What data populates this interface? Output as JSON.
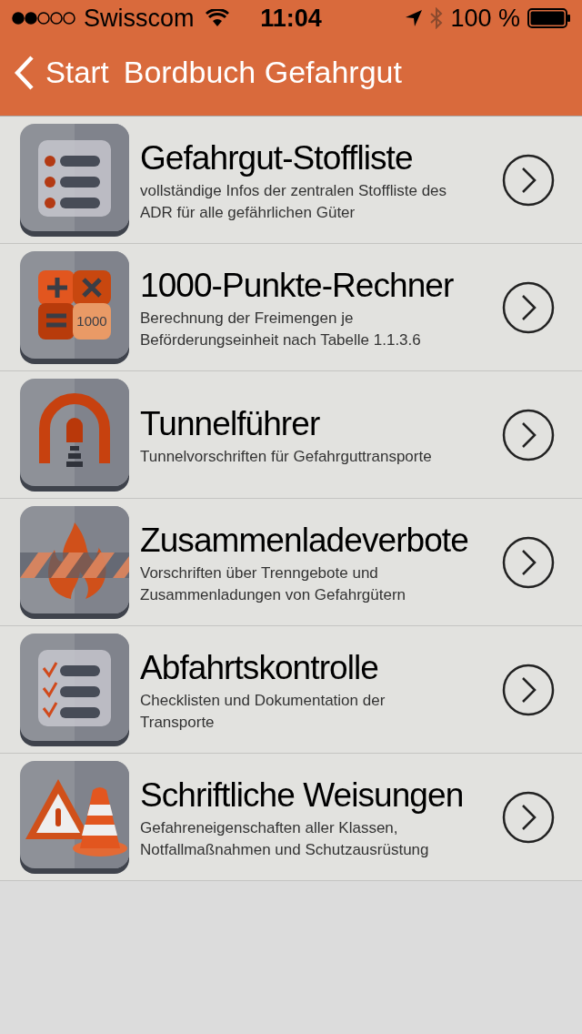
{
  "status_bar": {
    "carrier": "Swisscom",
    "time": "11:04",
    "battery": "100 %"
  },
  "nav": {
    "back": "Start",
    "title": "Bordbuch Gefahrgut"
  },
  "items": [
    {
      "kind": "list",
      "title": "Gefahrgut-Stoffliste",
      "description": "vollständige Infos der zentralen Stoffliste des ADR für alle gefährlichen Güter"
    },
    {
      "kind": "calculator",
      "icon_label": "1000",
      "title": "1000-Punkte-Rechner",
      "description": "Berechnung der Freimengen je Beförderungseinheit nach Tabelle 1.1.3.6"
    },
    {
      "kind": "tunnel",
      "title": "Tunnelführer",
      "description": "Tunnelvorschriften für Gefahrguttransporte"
    },
    {
      "kind": "fire",
      "title": "Zusammenladeverbote",
      "description": "Vorschriften über Trenngebote und Zusammenladungen von Gefahrgütern"
    },
    {
      "kind": "checklist",
      "title": "Abfahrtskontrolle",
      "description": "Checklisten und Dokumentation der Transporte"
    },
    {
      "kind": "warning",
      "title": "Schriftliche Weisungen",
      "description": "Gefahreneigenschaften aller Klassen, Notfallmaßnahmen und Schutzausrüstung"
    }
  ]
}
